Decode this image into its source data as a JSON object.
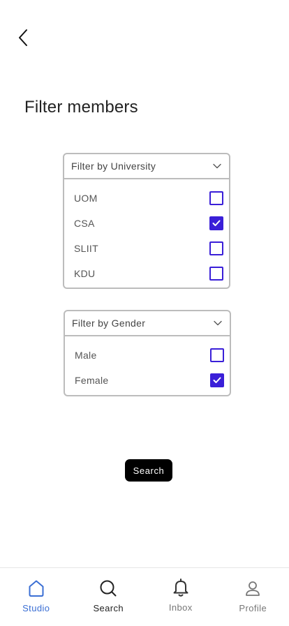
{
  "header": {
    "back_icon": "chevron-left-icon",
    "title": "Filter members"
  },
  "filters": {
    "university": {
      "header_label": "Filter by University",
      "expanded_icon": "chevron-down-icon",
      "options": [
        {
          "label": "UOM",
          "checked": false
        },
        {
          "label": "CSA",
          "checked": true
        },
        {
          "label": "SLIIT",
          "checked": false
        },
        {
          "label": "KDU",
          "checked": false
        }
      ]
    },
    "gender": {
      "header_label": "Filter by Gender",
      "expanded_icon": "chevron-down-icon",
      "options": [
        {
          "label": "Male",
          "checked": false
        },
        {
          "label": "Female",
          "checked": true
        }
      ]
    }
  },
  "actions": {
    "search_label": "Search"
  },
  "bottom_nav": {
    "items": [
      {
        "label": "Studio",
        "icon": "home-icon",
        "active": true
      },
      {
        "label": "Search",
        "icon": "search-icon",
        "active": false
      },
      {
        "label": "Inbox",
        "icon": "bell-icon",
        "active": false
      },
      {
        "label": "Profile",
        "icon": "user-icon",
        "active": false
      }
    ]
  },
  "colors": {
    "accent": "#3a1fd8",
    "nav_active": "#3b6fd4",
    "border": "#bcbcbc"
  }
}
